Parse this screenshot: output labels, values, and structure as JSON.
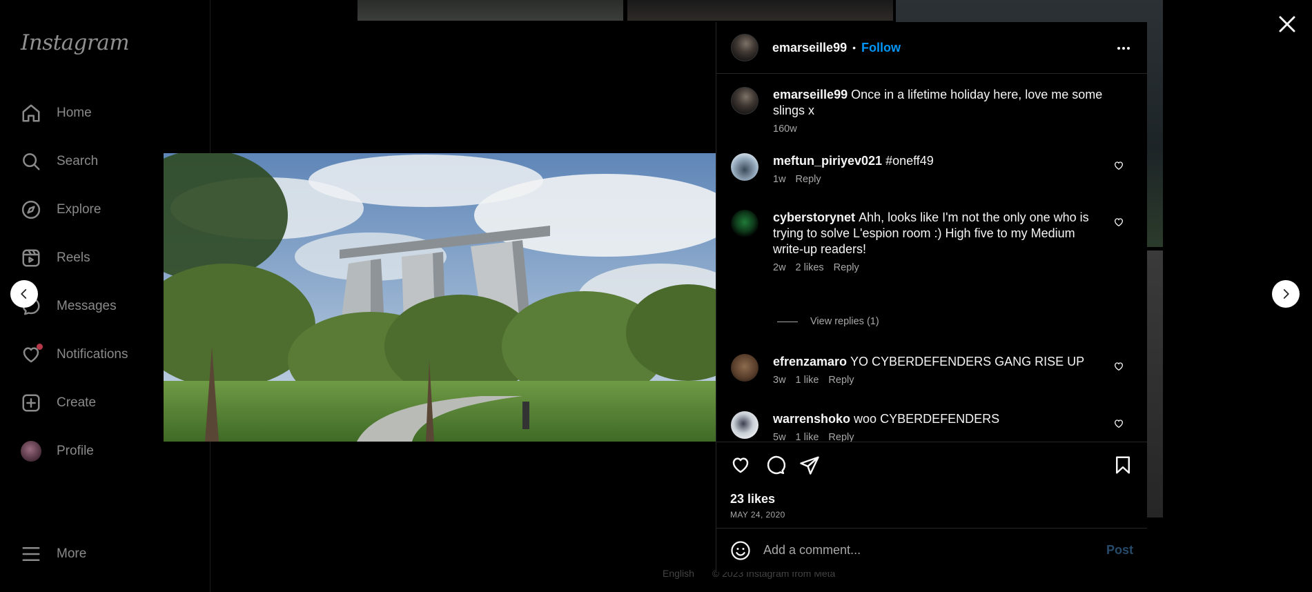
{
  "sidebar": {
    "logo": "Instagram",
    "items": [
      {
        "label": "Home",
        "icon": "home-icon"
      },
      {
        "label": "Search",
        "icon": "search-icon"
      },
      {
        "label": "Explore",
        "icon": "compass-icon"
      },
      {
        "label": "Reels",
        "icon": "reels-icon"
      },
      {
        "label": "Messages",
        "icon": "messenger-icon"
      },
      {
        "label": "Notifications",
        "icon": "heart-icon"
      },
      {
        "label": "Create",
        "icon": "plus-square-icon"
      },
      {
        "label": "Profile",
        "icon": "avatar"
      }
    ],
    "more_label": "More"
  },
  "footer": {
    "language": "English",
    "copyright": "© 2023 Instagram from Meta"
  },
  "post": {
    "owner": "emarseille99",
    "follow_label": "Follow",
    "caption": "Once in a lifetime holiday here, love me some slings x",
    "caption_age": "160w",
    "likes": "23 likes",
    "date": "MAY 24, 2020",
    "comment_placeholder": "Add a comment...",
    "post_label": "Post",
    "view_replies": "View replies (1)"
  },
  "comments": [
    {
      "user": "meftun_piriyev021",
      "text": "#oneff49",
      "age": "1w",
      "likes": "",
      "reply": "Reply"
    },
    {
      "user": "cyberstorynet",
      "text": "Ahh, looks like I'm not the only one who is trying to solve L'espion room :) High five to my Medium write-up readers!",
      "age": "2w",
      "likes": "2 likes",
      "reply": "Reply"
    },
    {
      "user": "efrenzamaro",
      "text": "YO CYBERDEFENDERS GANG RISE UP",
      "age": "3w",
      "likes": "1 like",
      "reply": "Reply"
    },
    {
      "user": "warrenshoko",
      "text": "woo CYBERDEFENDERS",
      "age": "5w",
      "likes": "1 like",
      "reply": "Reply"
    }
  ],
  "colors": {
    "background": "#000000",
    "text": "#f5f5f5",
    "secondary_text": "#a8a8a8",
    "follow_blue": "#0095f6",
    "post_disabled": "#264b6a",
    "border": "#262626"
  }
}
